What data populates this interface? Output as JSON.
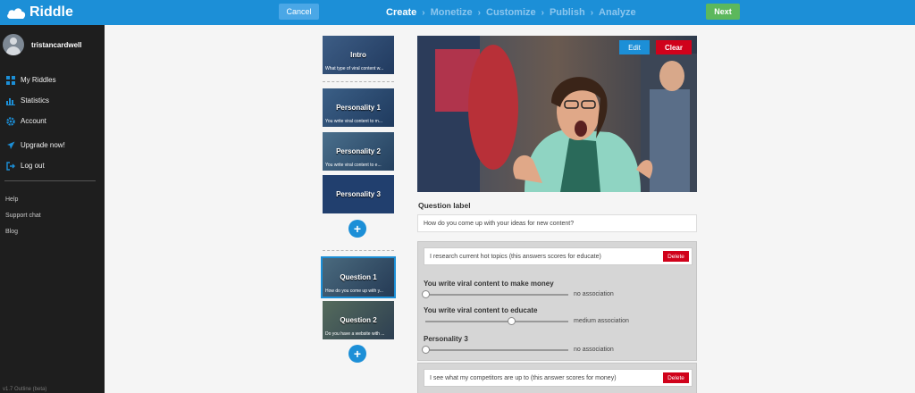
{
  "app": {
    "name": "Riddle"
  },
  "topbar": {
    "cancel_label": "Cancel",
    "next_label": "Next",
    "steps": [
      "Create",
      "Monetize",
      "Customize",
      "Publish",
      "Analyze"
    ]
  },
  "sidebar": {
    "username": "tristancardwell",
    "nav": [
      {
        "label": "My Riddles",
        "icon": "grid-icon"
      },
      {
        "label": "Statistics",
        "icon": "bar-chart-icon"
      },
      {
        "label": "Account",
        "icon": "gear-icon"
      },
      {
        "label": "Upgrade now!",
        "icon": "rocket-icon"
      },
      {
        "label": "Log out",
        "icon": "logout-icon"
      }
    ],
    "links": [
      "Help",
      "Support chat",
      "Blog"
    ],
    "version": "v1.7 Outline (beta)"
  },
  "slides": {
    "intro": {
      "title": "Intro",
      "subtitle": "What type of viral content w..."
    },
    "personalities": [
      {
        "title": "Personality 1",
        "subtitle": "You write viral content to m..."
      },
      {
        "title": "Personality 2",
        "subtitle": "You write viral content to e..."
      },
      {
        "title": "Personality 3",
        "subtitle": ""
      }
    ],
    "questions": [
      {
        "title": "Question 1",
        "subtitle": "How do you come up with y..."
      },
      {
        "title": "Question 2",
        "subtitle": "Do you have a website with ..."
      }
    ],
    "add_label": "+"
  },
  "editor": {
    "edit_label": "Edit",
    "clear_label": "Clear",
    "question_label_heading": "Question label",
    "question_value": "How do you come up with your ideas for new content?",
    "delete_label": "Delete",
    "answers": [
      {
        "text": "I research current hot topics (this answers scores for educate)",
        "scores": [
          {
            "name": "You write viral content to make money",
            "level": 0,
            "association": "no association"
          },
          {
            "name": "You write viral content to educate",
            "level": 0.6,
            "association": "medium association"
          },
          {
            "name": "Personality 3",
            "level": 0,
            "association": "no association"
          }
        ]
      },
      {
        "text": "I see what my competitors are up to (this answer scores for money)",
        "scores": []
      }
    ]
  },
  "colors": {
    "primary": "#1c8fd7",
    "danger": "#d0021b",
    "success": "#5cb85c",
    "sidebar": "#1e1e1e"
  }
}
